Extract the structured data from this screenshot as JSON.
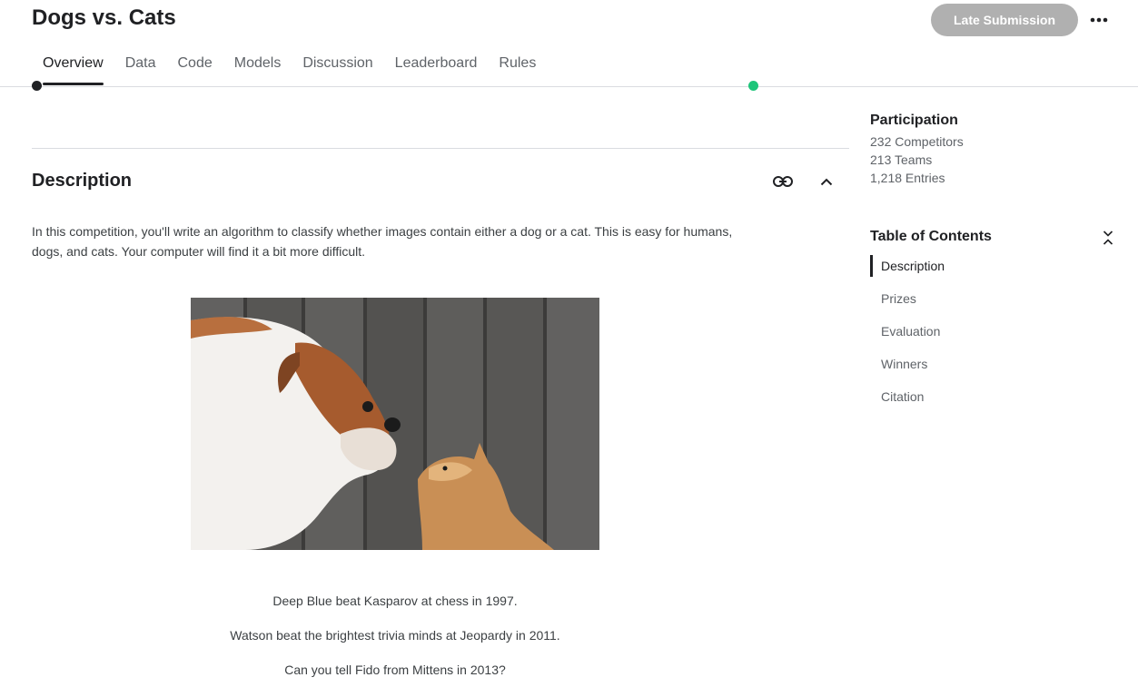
{
  "header": {
    "title": "Dogs vs. Cats",
    "late_submission_label": "Late Submission",
    "more_icon": "more-horizontal-icon",
    "tabs": [
      {
        "label": "Overview",
        "active": true
      },
      {
        "label": "Data"
      },
      {
        "label": "Code"
      },
      {
        "label": "Models"
      },
      {
        "label": "Discussion"
      },
      {
        "label": "Leaderboard"
      },
      {
        "label": "Rules"
      }
    ]
  },
  "main": {
    "section_title": "Description",
    "link_icon": "link-icon",
    "collapse_icon": "chevron-up-icon",
    "description": "In this competition, you'll write an algorithm to classify whether images contain either a dog or a cat.  This is easy for humans, dogs, and cats. Your computer will find it a bit more difficult.",
    "quotes": [
      "Deep Blue beat Kasparov at chess in 1997.",
      "Watson beat the brightest trivia minds at Jeopardy in 2011.",
      "Can you tell Fido from Mittens in 2013?"
    ]
  },
  "sidebar": {
    "participation_title": "Participation",
    "stats": [
      "232 Competitors",
      "213 Teams",
      "1,218 Entries"
    ],
    "toc_title": "Table of Contents",
    "toc_collapse_icon": "collapse-vertical-icon",
    "toc_items": [
      {
        "label": "Description",
        "active": true
      },
      {
        "label": "Prizes"
      },
      {
        "label": "Evaluation"
      },
      {
        "label": "Winners"
      },
      {
        "label": "Citation"
      }
    ]
  },
  "colors": {
    "primary_text": "#202124",
    "secondary_text": "#5f6368",
    "disabled_button": "#b0b0b0",
    "status_green": "#1ec57a"
  }
}
